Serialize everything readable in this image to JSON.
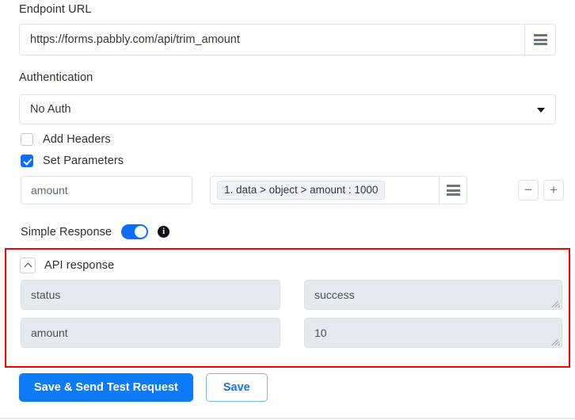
{
  "endpoint": {
    "label": "Endpoint URL",
    "value": "https://forms.pabbly.com/api/trim_amount",
    "menu_icon": "hamburger-icon"
  },
  "authentication": {
    "label": "Authentication",
    "selected": "No Auth",
    "caret_icon": "caret-down-icon"
  },
  "options": {
    "add_headers": {
      "label": "Add Headers",
      "checked": false
    },
    "set_parameters": {
      "label": "Set Parameters",
      "checked": true
    }
  },
  "parameters": {
    "rows": [
      {
        "key": "amount",
        "value_chip": "1. data > object > amount : 1000",
        "menu_icon": "hamburger-icon"
      }
    ],
    "remove_label": "−",
    "add_label": "+"
  },
  "simple_response": {
    "label": "Simple Response",
    "enabled": true,
    "info_icon": "info-icon",
    "info_glyph": "i"
  },
  "api_response": {
    "title": "API response",
    "collapse_icon": "chevron-up-icon",
    "fields": [
      {
        "key": "status",
        "value": "success"
      },
      {
        "key": "amount",
        "value": "10"
      }
    ]
  },
  "footer": {
    "primary_label": "Save & Send Test Request",
    "secondary_label": "Save"
  },
  "colors": {
    "accent_blue": "#0d6efd",
    "button_blue": "#0d7bf7",
    "highlight_red": "#ff0000",
    "disabled_bg": "#e6eaee",
    "chip_bg": "#eef1f6"
  }
}
